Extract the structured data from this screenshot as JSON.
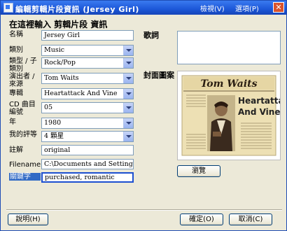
{
  "window": {
    "title": "編輯剪輯片段資訊 (Jersey Girl)",
    "menu_options": "檢視(V)",
    "menu_select": "選項(P)",
    "close_glyph": "✕"
  },
  "header": "在這裡輸入  剪輯片段  資訊",
  "fields": {
    "name": {
      "label": "名稱",
      "value": "Jersey Girl"
    },
    "genre": {
      "label": "類別",
      "value": "Music"
    },
    "subgenre": {
      "label": "類型 / 子類別",
      "value": "Rock/Pop"
    },
    "artist": {
      "label": "演出者 / 來源",
      "value": "Tom Waits"
    },
    "album": {
      "label": "專輯",
      "value": "Heartattack And Vine"
    },
    "track": {
      "label": "CD 曲目編號",
      "value": "05"
    },
    "year": {
      "label": "年",
      "value": "1980"
    },
    "rating": {
      "label": "我的評等",
      "value": "4 顆星"
    },
    "comment": {
      "label": "註解",
      "value": "original"
    },
    "filename": {
      "label": "Filename",
      "value": "C:\\Documents and Settings\\Admin\\M"
    },
    "keywords": {
      "label": "關鍵字",
      "value": "purchased, romantic"
    }
  },
  "lyrics_label": "歌詞",
  "cover_label": "封面圖案",
  "cover_art": {
    "artist": "Tom Waits",
    "album_line1": "Heartattack",
    "album_line2": "And Vine"
  },
  "buttons": {
    "browse": "瀏覽",
    "help": "說明(H)",
    "ok": "確定(O)",
    "cancel": "取消(C)"
  },
  "colors": {
    "title_bar": "#1c57d8",
    "selected_label": "#316ac5",
    "close_button": "#d9532c"
  }
}
